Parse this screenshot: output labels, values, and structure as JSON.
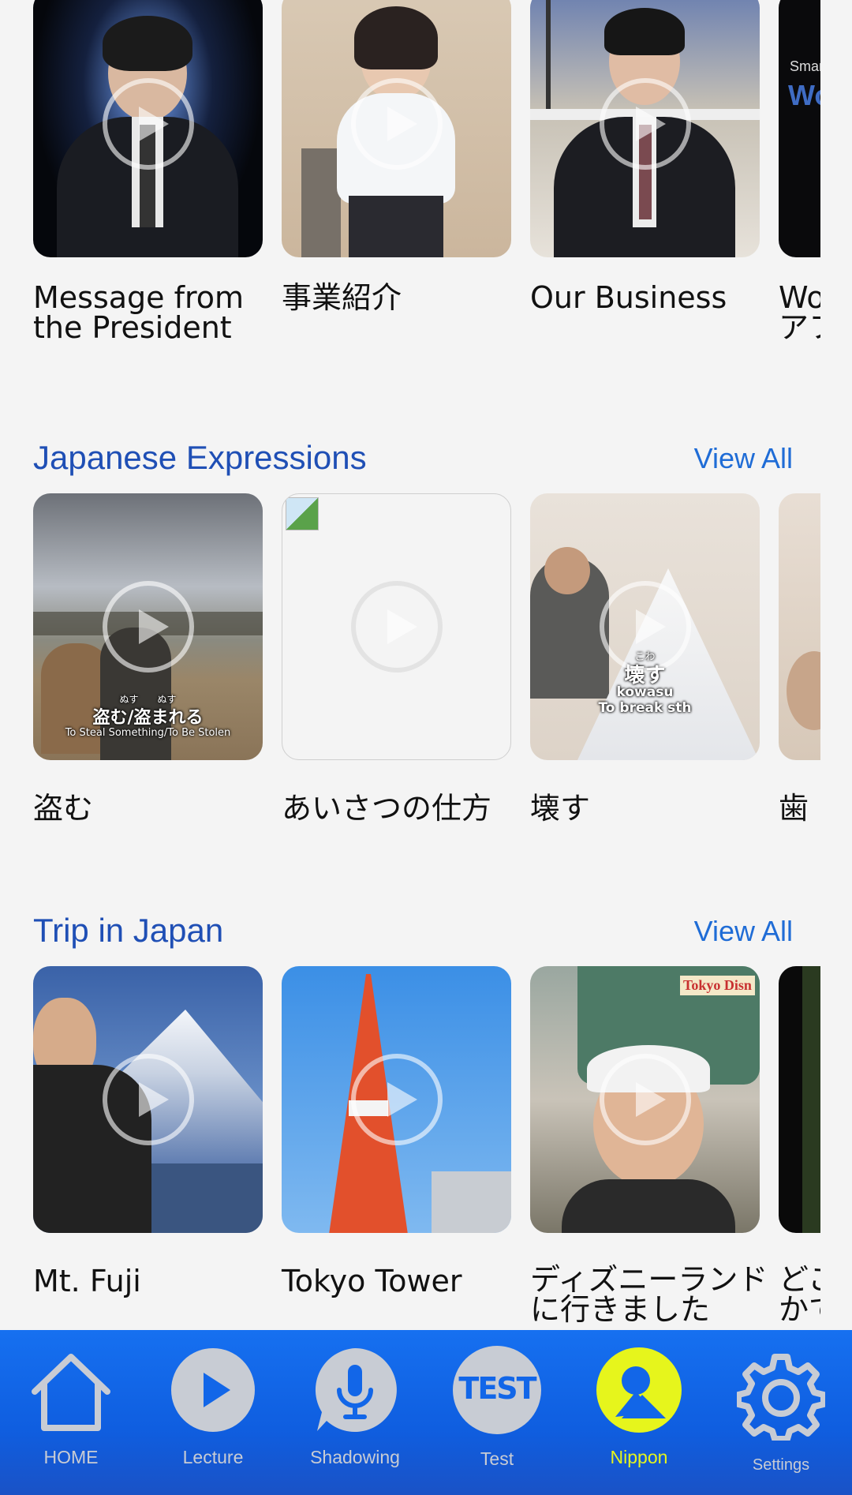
{
  "top_row": {
    "cards": [
      {
        "title": "Message from\nthe President"
      },
      {
        "title": "事業紹介"
      },
      {
        "title": "Our Business"
      },
      {
        "title": "Wo\nアフ",
        "thumb_text_small": "Smar",
        "thumb_text_big": "Wo"
      }
    ]
  },
  "japanese_expressions": {
    "title": "Japanese Expressions",
    "view_all": "View All",
    "cards": [
      {
        "title": "盗む",
        "furigana": "ぬす　　ぬす",
        "caption_jp": "盗む/盗まれる",
        "caption_en": "To Steal Something/To Be Stolen"
      },
      {
        "title": "あいさつの仕方"
      },
      {
        "title": "壊す",
        "furigana": "こわ",
        "caption_jp": "壊す",
        "caption_romaji": "kowasu",
        "caption_en": "To break sth"
      },
      {
        "title": "歯"
      }
    ]
  },
  "trip_in_japan": {
    "title": "Trip in Japan",
    "view_all": "View All",
    "cards": [
      {
        "title": "Mt. Fuji"
      },
      {
        "title": "Tokyo Tower"
      },
      {
        "title": "ディズニーランド\nに行きました",
        "sign_text": "Tokyo Disn"
      },
      {
        "title": "どこ\nかで"
      }
    ]
  },
  "nav": {
    "items": [
      {
        "label": "HOME",
        "icon": "home-icon"
      },
      {
        "label": "Lecture",
        "icon": "play-icon"
      },
      {
        "label": "Shadowing",
        "icon": "microphone-icon"
      },
      {
        "label": "Test",
        "icon": "test-icon",
        "icon_text": "TEST"
      },
      {
        "label": "Nippon",
        "icon": "nippon-icon"
      },
      {
        "label": "Settings",
        "icon": "gear-icon"
      }
    ],
    "active": "Nippon",
    "active_color": "#e6f51c",
    "inactive_color": "#c8ccd4",
    "background": "#1266e8"
  }
}
